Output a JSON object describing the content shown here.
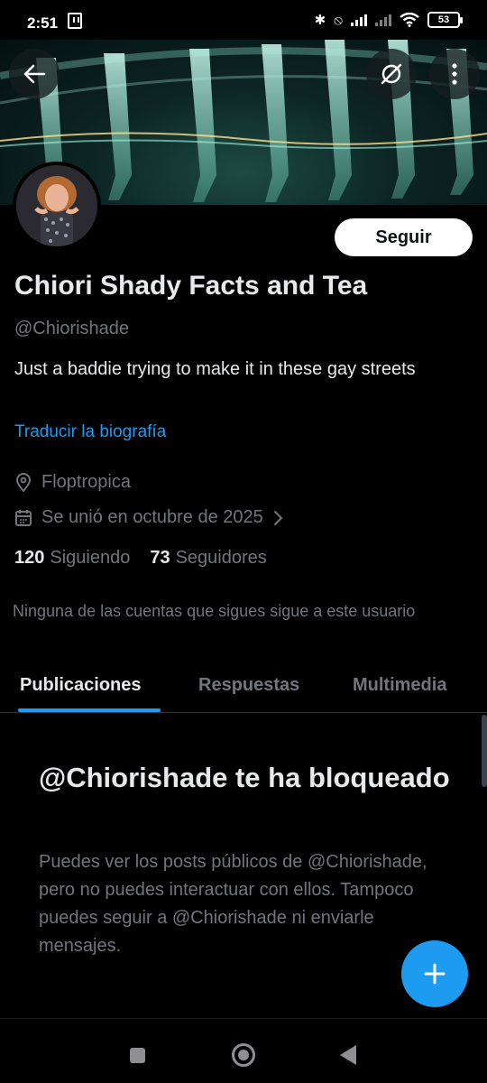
{
  "status_bar": {
    "time": "2:51",
    "battery": "53"
  },
  "profile": {
    "display_name": "Chiori Shady Facts and Tea",
    "handle": "@Chiorishade",
    "bio": "Just a baddie trying to make it in these gay streets",
    "translate_bio": "Traducir la biografía",
    "location": "Floptropica",
    "joined": "Se unió en octubre de 2025",
    "following_count": "120",
    "following_label": "Siguiendo",
    "followers_count": "73",
    "followers_label": "Seguidores",
    "mutual_note": "Ninguna de las cuentas que sigues sigue a este usuario"
  },
  "actions": {
    "follow_label": "Seguir"
  },
  "tabs": [
    {
      "label": "Publicaciones",
      "active": true
    },
    {
      "label": "Respuestas",
      "active": false
    },
    {
      "label": "Multimedia",
      "active": false
    }
  ],
  "blocked": {
    "title": "@Chiorishade te ha bloqueado",
    "description": "Puedes ver los posts públicos de @Chiorishade, pero no puedes interactuar con ellos. Tampoco puedes seguir a @Chiorishade ni enviarle mensajes."
  },
  "colors": {
    "accent": "#1d9bf0",
    "background": "#000000",
    "secondary_text": "#71767b"
  },
  "icons": [
    "back-arrow-icon",
    "grok-icon",
    "more-vertical-icon",
    "location-pin-icon",
    "calendar-icon",
    "chevron-right-icon",
    "plus-icon"
  ]
}
